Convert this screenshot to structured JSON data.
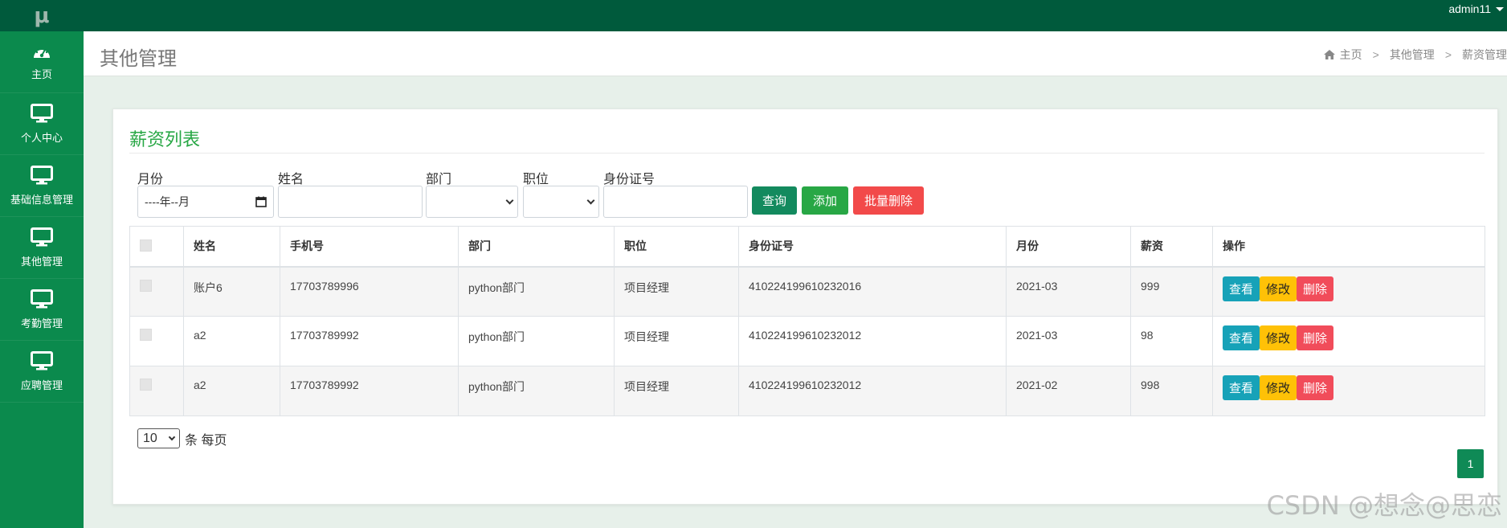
{
  "app": {
    "logo_text": "μ",
    "user": "admin11"
  },
  "sidebar": {
    "items": [
      {
        "label": "主页",
        "icon": "dashboard-icon"
      },
      {
        "label": "个人中心",
        "icon": "monitor-icon"
      },
      {
        "label": "基础信息管理",
        "icon": "monitor-icon"
      },
      {
        "label": "其他管理",
        "icon": "monitor-icon"
      },
      {
        "label": "考勤管理",
        "icon": "monitor-icon"
      },
      {
        "label": "应聘管理",
        "icon": "monitor-icon"
      }
    ]
  },
  "header": {
    "title": "其他管理",
    "breadcrumb": [
      "主页",
      "其他管理",
      "薪资管理"
    ]
  },
  "card": {
    "title": "薪资列表"
  },
  "filters": {
    "month_label": "月份",
    "month_placeholder": "----年--月",
    "name_label": "姓名",
    "dept_label": "部门",
    "position_label": "职位",
    "id_label": "身份证号",
    "query_button": "查询",
    "add_button": "添加",
    "batch_delete_button": "批量删除"
  },
  "table": {
    "headers": [
      "姓名",
      "手机号",
      "部门",
      "职位",
      "身份证号",
      "月份",
      "薪资",
      "操作"
    ],
    "rows": [
      {
        "name": "账户6",
        "phone": "17703789996",
        "dept": "python部门",
        "position": "项目经理",
        "id_number": "410224199610232016",
        "month": "2021-03",
        "salary": "999"
      },
      {
        "name": "a2",
        "phone": "17703789992",
        "dept": "python部门",
        "position": "项目经理",
        "id_number": "410224199610232012",
        "month": "2021-03",
        "salary": "98"
      },
      {
        "name": "a2",
        "phone": "17703789992",
        "dept": "python部门",
        "position": "项目经理",
        "id_number": "410224199610232012",
        "month": "2021-02",
        "salary": "998"
      }
    ],
    "actions": {
      "view": "查看",
      "edit": "修改",
      "delete": "删除"
    }
  },
  "pagination": {
    "page_size": "10",
    "page_size_suffix": "条 每页",
    "current_page": "1"
  },
  "watermark": "CSDN @想念@思恋",
  "colors": {
    "topbar": "#005a3c",
    "sidebar": "#0b8a4d",
    "title_green": "#28a745",
    "query": "#138a5e",
    "add": "#28a745",
    "danger": "#f24a4a",
    "info": "#17a2b8",
    "warning": "#ffc107",
    "delete": "#f14c5a"
  }
}
